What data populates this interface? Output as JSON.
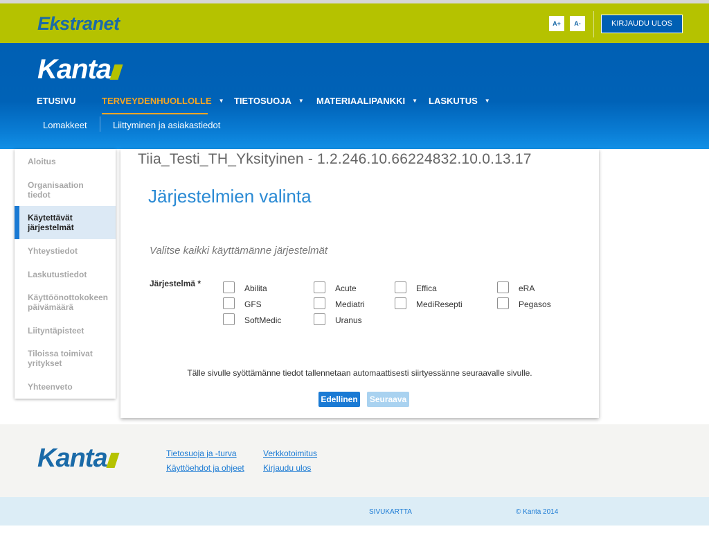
{
  "topbar": {
    "brand": "Ekstranet",
    "font_increase": "A+",
    "font_decrease": "A-",
    "logout": "KIRJAUDU ULOS",
    "color": "#b5c200"
  },
  "header": {
    "logo": "Kanta",
    "nav": [
      {
        "label": "ETUSIVU",
        "caret": ""
      },
      {
        "label": "TERVEYDENHUOLLOLLE",
        "caret": "▼"
      },
      {
        "label": "TIETOSUOJA",
        "caret": "▼"
      },
      {
        "label": "MATERIAALIPANKKI",
        "caret": "▼"
      },
      {
        "label": "LASKUTUS",
        "caret": "▼"
      }
    ],
    "subnav": [
      "Lomakkeet",
      "Liittyminen ja asiakastiedot"
    ],
    "color": "#005fb3",
    "active_color": "#f5a623"
  },
  "sidebar": {
    "items": [
      {
        "line1": "Aloitus",
        "line2": ""
      },
      {
        "line1": "Organisaation",
        "line2": "tiedot"
      },
      {
        "line1": "Käytettävät",
        "line2": "järjestelmät"
      },
      {
        "line1": "Yhteystiedot",
        "line2": ""
      },
      {
        "line1": "Laskutustiedot",
        "line2": ""
      },
      {
        "line1": "Käyttöönottokokeen",
        "line2": "päivämäärä"
      },
      {
        "line1": "Liityntäpisteet",
        "line2": ""
      },
      {
        "line1": "Tiloissa toimivat",
        "line2": "yritykset"
      },
      {
        "line1": "Yhteenveto",
        "line2": ""
      }
    ],
    "active_index": 2
  },
  "main": {
    "org_title": "Tiia_Testi_TH_Yksityinen - 1.2.246.10.66224832.10.0.13.17",
    "page_title": "Järjestelmien valinta",
    "instruction": "Valitse kaikki käyttämänne järjestelmät",
    "field_label": "Järjestelmä *",
    "systems": [
      "Abilita",
      "Acute",
      "Effica",
      "eRA",
      "GFS",
      "Mediatri",
      "MediResepti",
      "Pegasos",
      "SoftMedic",
      "Uranus"
    ],
    "checked": [
      false,
      false,
      false,
      false,
      false,
      false,
      false,
      false,
      false,
      false
    ],
    "note": "Tälle sivulle syöttämänne tiedot tallennetaan automaattisesti siirtyessänne seuraavalle sivulle.",
    "prev_button": "Edellinen",
    "next_button": "Seuraava"
  },
  "footer": {
    "logo": "Kanta",
    "links": [
      "Tietosuoja ja -turva",
      "Käyttöehdot ja ohjeet",
      "Verkkotoimitus",
      "Kirjaudu ulos"
    ],
    "sitemap": "SIVUKARTTA",
    "copyright": "© Kanta 2014"
  }
}
